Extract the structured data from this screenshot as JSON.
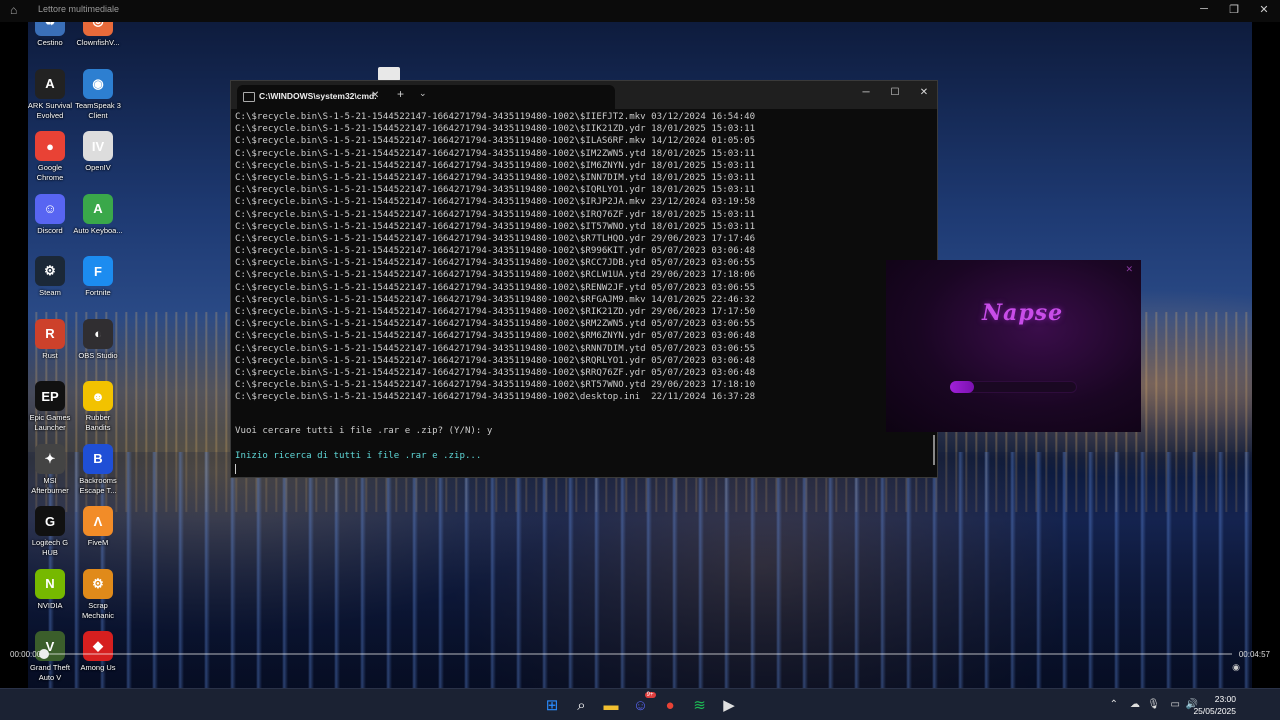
{
  "player": {
    "title": "Lettore multimediale",
    "time_elapsed": "00:00:00",
    "time_total": "00:04:57",
    "progress_fraction": 0.0
  },
  "desktop_icons": [
    {
      "label": "Cestino",
      "icon": "recycle-bin-icon",
      "color": "#3a6fb8"
    },
    {
      "label": "ClownfishV...",
      "icon": "clownfish-icon",
      "color": "#e86a3a"
    },
    {
      "label": "ARK Survival Evolved",
      "icon": "ark-icon",
      "color": "#222222"
    },
    {
      "label": "TeamSpeak 3 Client",
      "icon": "teamspeak-icon",
      "color": "#2d7fd1"
    },
    {
      "label": "Google Chrome",
      "icon": "chrome-icon",
      "color": "#e94235"
    },
    {
      "label": "OpenIV",
      "icon": "openiv-icon",
      "color": "#dddddd"
    },
    {
      "label": "Discord",
      "icon": "discord-icon",
      "color": "#5865f2"
    },
    {
      "label": "Auto Keyboa...",
      "icon": "auto-keyboard-icon",
      "color": "#3aa84a"
    },
    {
      "label": "Steam",
      "icon": "steam-icon",
      "color": "#1b2838"
    },
    {
      "label": "Fortnite",
      "icon": "fortnite-icon",
      "color": "#1c8cf0"
    },
    {
      "label": "Rust",
      "icon": "rust-icon",
      "color": "#cd412b"
    },
    {
      "label": "OBS Studio",
      "icon": "obs-icon",
      "color": "#302e31"
    },
    {
      "label": "Epic Games Launcher",
      "icon": "epic-games-icon",
      "color": "#111111"
    },
    {
      "label": "Rubber Bandits",
      "icon": "rubber-bandits-icon",
      "color": "#f2c200"
    },
    {
      "label": "MSI Afterburner",
      "icon": "msi-afterburner-icon",
      "color": "#444444"
    },
    {
      "label": "Backrooms Escape T...",
      "icon": "backrooms-icon",
      "color": "#1f4fd6"
    },
    {
      "label": "Logitech G HUB",
      "icon": "logitech-ghub-icon",
      "color": "#111111"
    },
    {
      "label": "FiveM",
      "icon": "fivem-icon",
      "color": "#f28c28"
    },
    {
      "label": "NVIDIA",
      "icon": "nvidia-icon",
      "color": "#76b900"
    },
    {
      "label": "Scrap Mechanic",
      "icon": "scrap-mechanic-icon",
      "color": "#e08a1a"
    },
    {
      "label": "Grand Theft Auto V",
      "icon": "gta-v-icon",
      "color": "#3b5e2b"
    },
    {
      "label": "Among Us",
      "icon": "among-us-icon",
      "color": "#d61f1f"
    }
  ],
  "terminal": {
    "tab_title": "C:\\WINDOWS\\system32\\cmd.",
    "lines": [
      "C:\\$recycle.bin\\S-1-5-21-1544522147-1664271794-3435119480-1002\\$IIEFJT2.mkv 03/12/2024 16:54:40",
      "C:\\$recycle.bin\\S-1-5-21-1544522147-1664271794-3435119480-1002\\$IIK21ZD.ydr 18/01/2025 15:03:11",
      "C:\\$recycle.bin\\S-1-5-21-1544522147-1664271794-3435119480-1002\\$ILAS6RF.mkv 14/12/2024 01:05:05",
      "C:\\$recycle.bin\\S-1-5-21-1544522147-1664271794-3435119480-1002\\$IM2ZWN5.ytd 18/01/2025 15:03:11",
      "C:\\$recycle.bin\\S-1-5-21-1544522147-1664271794-3435119480-1002\\$IM6ZNYN.ydr 18/01/2025 15:03:11",
      "C:\\$recycle.bin\\S-1-5-21-1544522147-1664271794-3435119480-1002\\$INN7DIM.ytd 18/01/2025 15:03:11",
      "C:\\$recycle.bin\\S-1-5-21-1544522147-1664271794-3435119480-1002\\$IQRLYO1.ydr 18/01/2025 15:03:11",
      "C:\\$recycle.bin\\S-1-5-21-1544522147-1664271794-3435119480-1002\\$IRJP2JA.mkv 23/12/2024 03:19:58",
      "C:\\$recycle.bin\\S-1-5-21-1544522147-1664271794-3435119480-1002\\$IRQ76ZF.ydr 18/01/2025 15:03:11",
      "C:\\$recycle.bin\\S-1-5-21-1544522147-1664271794-3435119480-1002\\$IT57WNO.ytd 18/01/2025 15:03:11",
      "C:\\$recycle.bin\\S-1-5-21-1544522147-1664271794-3435119480-1002\\$R7TLHQO.ydr 29/06/2023 17:17:46",
      "C:\\$recycle.bin\\S-1-5-21-1544522147-1664271794-3435119480-1002\\$R996KIT.ydr 05/07/2023 03:06:48",
      "C:\\$recycle.bin\\S-1-5-21-1544522147-1664271794-3435119480-1002\\$RCC7JDB.ytd 05/07/2023 03:06:55",
      "C:\\$recycle.bin\\S-1-5-21-1544522147-1664271794-3435119480-1002\\$RCLW1UA.ytd 29/06/2023 17:18:06",
      "C:\\$recycle.bin\\S-1-5-21-1544522147-1664271794-3435119480-1002\\$RENW2JF.ytd 05/07/2023 03:06:55",
      "C:\\$recycle.bin\\S-1-5-21-1544522147-1664271794-3435119480-1002\\$RFGAJM9.mkv 14/01/2025 22:46:32",
      "C:\\$recycle.bin\\S-1-5-21-1544522147-1664271794-3435119480-1002\\$RIK21ZD.ydr 29/06/2023 17:17:50",
      "C:\\$recycle.bin\\S-1-5-21-1544522147-1664271794-3435119480-1002\\$RM2ZWN5.ytd 05/07/2023 03:06:55",
      "C:\\$recycle.bin\\S-1-5-21-1544522147-1664271794-3435119480-1002\\$RM6ZNYN.ydr 05/07/2023 03:06:48",
      "C:\\$recycle.bin\\S-1-5-21-1544522147-1664271794-3435119480-1002\\$RNN7DIM.ytd 05/07/2023 03:06:55",
      "C:\\$recycle.bin\\S-1-5-21-1544522147-1664271794-3435119480-1002\\$RQRLYO1.ydr 05/07/2023 03:06:48",
      "C:\\$recycle.bin\\S-1-5-21-1544522147-1664271794-3435119480-1002\\$RRQ76ZF.ydr 05/07/2023 03:06:48",
      "C:\\$recycle.bin\\S-1-5-21-1544522147-1664271794-3435119480-1002\\$RT57WNO.ytd 29/06/2023 17:18:10",
      "C:\\$recycle.bin\\S-1-5-21-1544522147-1664271794-3435119480-1002\\desktop.ini  22/11/2024 16:37:28"
    ],
    "prompt": "Vuoi cercare tutti i file .rar e .zip? (Y/N): y",
    "status": "Inizio ricerca di tutti i file .rar e .zip..."
  },
  "napse": {
    "logo_text": "Napse",
    "progress_fraction": 0.19,
    "accent": "#a021d8"
  },
  "taskbar": {
    "apps": [
      {
        "icon": "windows-start-icon",
        "color": "#2a8cff"
      },
      {
        "icon": "search-icon",
        "color": "#ffffff"
      },
      {
        "icon": "file-explorer-icon",
        "color": "#f2c030"
      },
      {
        "icon": "discord-icon",
        "color": "#5865f2",
        "badge": "9+"
      },
      {
        "icon": "chrome-icon",
        "color": "#e94235"
      },
      {
        "icon": "spotify-icon",
        "color": "#1db954"
      },
      {
        "icon": "media-player-icon",
        "color": "#e0e0e0"
      }
    ],
    "clock_time": "23:00",
    "clock_date": "25/05/2025"
  }
}
